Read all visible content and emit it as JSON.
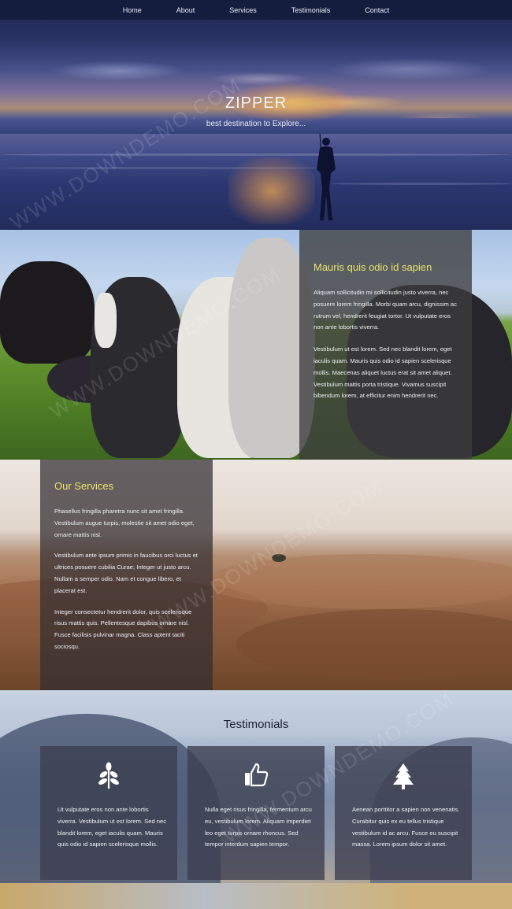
{
  "nav": {
    "items": [
      "Home",
      "About",
      "Services",
      "Testimonials",
      "Contact"
    ]
  },
  "hero": {
    "title": "ZIPPER",
    "subtitle": "best destination to Explore..."
  },
  "about": {
    "title": "Mauris quis odio id sapien",
    "paragraphs": [
      "Aliquam sollicitudin mi sollicitudin justo viverra, nec posuere lorem fringilla. Morbi quam arcu, dignissim ac rutrum vel, hendrerit feugiat tortor. Ut vulputate eros non ante lobortis viverra.",
      "Vestibulum ut est lorem. Sed nec blandit lorem, eget iaculis quam. Mauris quis odio id sapien scelerisque mollis. Maecenas aliquet luctus erat sit amet aliquet. Vestibulum mattis porta tristique. Vivamus suscipit bibendum lorem, at efficitur enim hendrerit nec."
    ]
  },
  "services": {
    "title": "Our Services",
    "paragraphs": [
      "Phasellus fringilla pharetra nunc sit amet fringilla. Vestibulum augue turpis, molestie sit amet odio eget, ornare mattis nisl.",
      "Vestibulum ante ipsum primis in faucibus orci luctus et ultrices posuere cubilia Curae; Integer ut justo arcu. Nullam a semper odio. Nam et congue libero, et placerat est.",
      "Integer consectetur hendrerit dolor, quis scelerisque risus mattis quis. Pellentesque dapibus ornare nisl. Fusce facilisis pulvinar magna. Class aptent taciti sociosqu."
    ]
  },
  "testimonials": {
    "title": "Testimonials",
    "cards": [
      {
        "icon": "leaf-icon",
        "text": "Ut vulputate eros non ante lobortis viverra. Vestibulum ut est lorem. Sed nec blandit lorem, eget iaculis quam. Mauris quis odio id sapien scelerisque mollis."
      },
      {
        "icon": "thumbs-up-icon",
        "text": "Nulla eget risus fringilla, fermentum arcu eu, vestibulum lorem. Aliquam imperdiet leo eget turpis ornare rhoncus. Sed tempor interdum sapien tempor."
      },
      {
        "icon": "tree-icon",
        "text": "Aenean porttitor a sapien non venenatis. Curabitur quis ex eu tellus tristique vestibulum id ac arcu. Fusce eu suscipit massa. Lorem ipsum dolor sit amet."
      }
    ]
  },
  "watermark": "WWW.DOWNDEMO.COM",
  "colors": {
    "nav_bg": "#141c3c",
    "heading_accent": "#e9e26c",
    "panel_bg": "#3c3c3e",
    "card_bg": "#3c3e4e"
  }
}
